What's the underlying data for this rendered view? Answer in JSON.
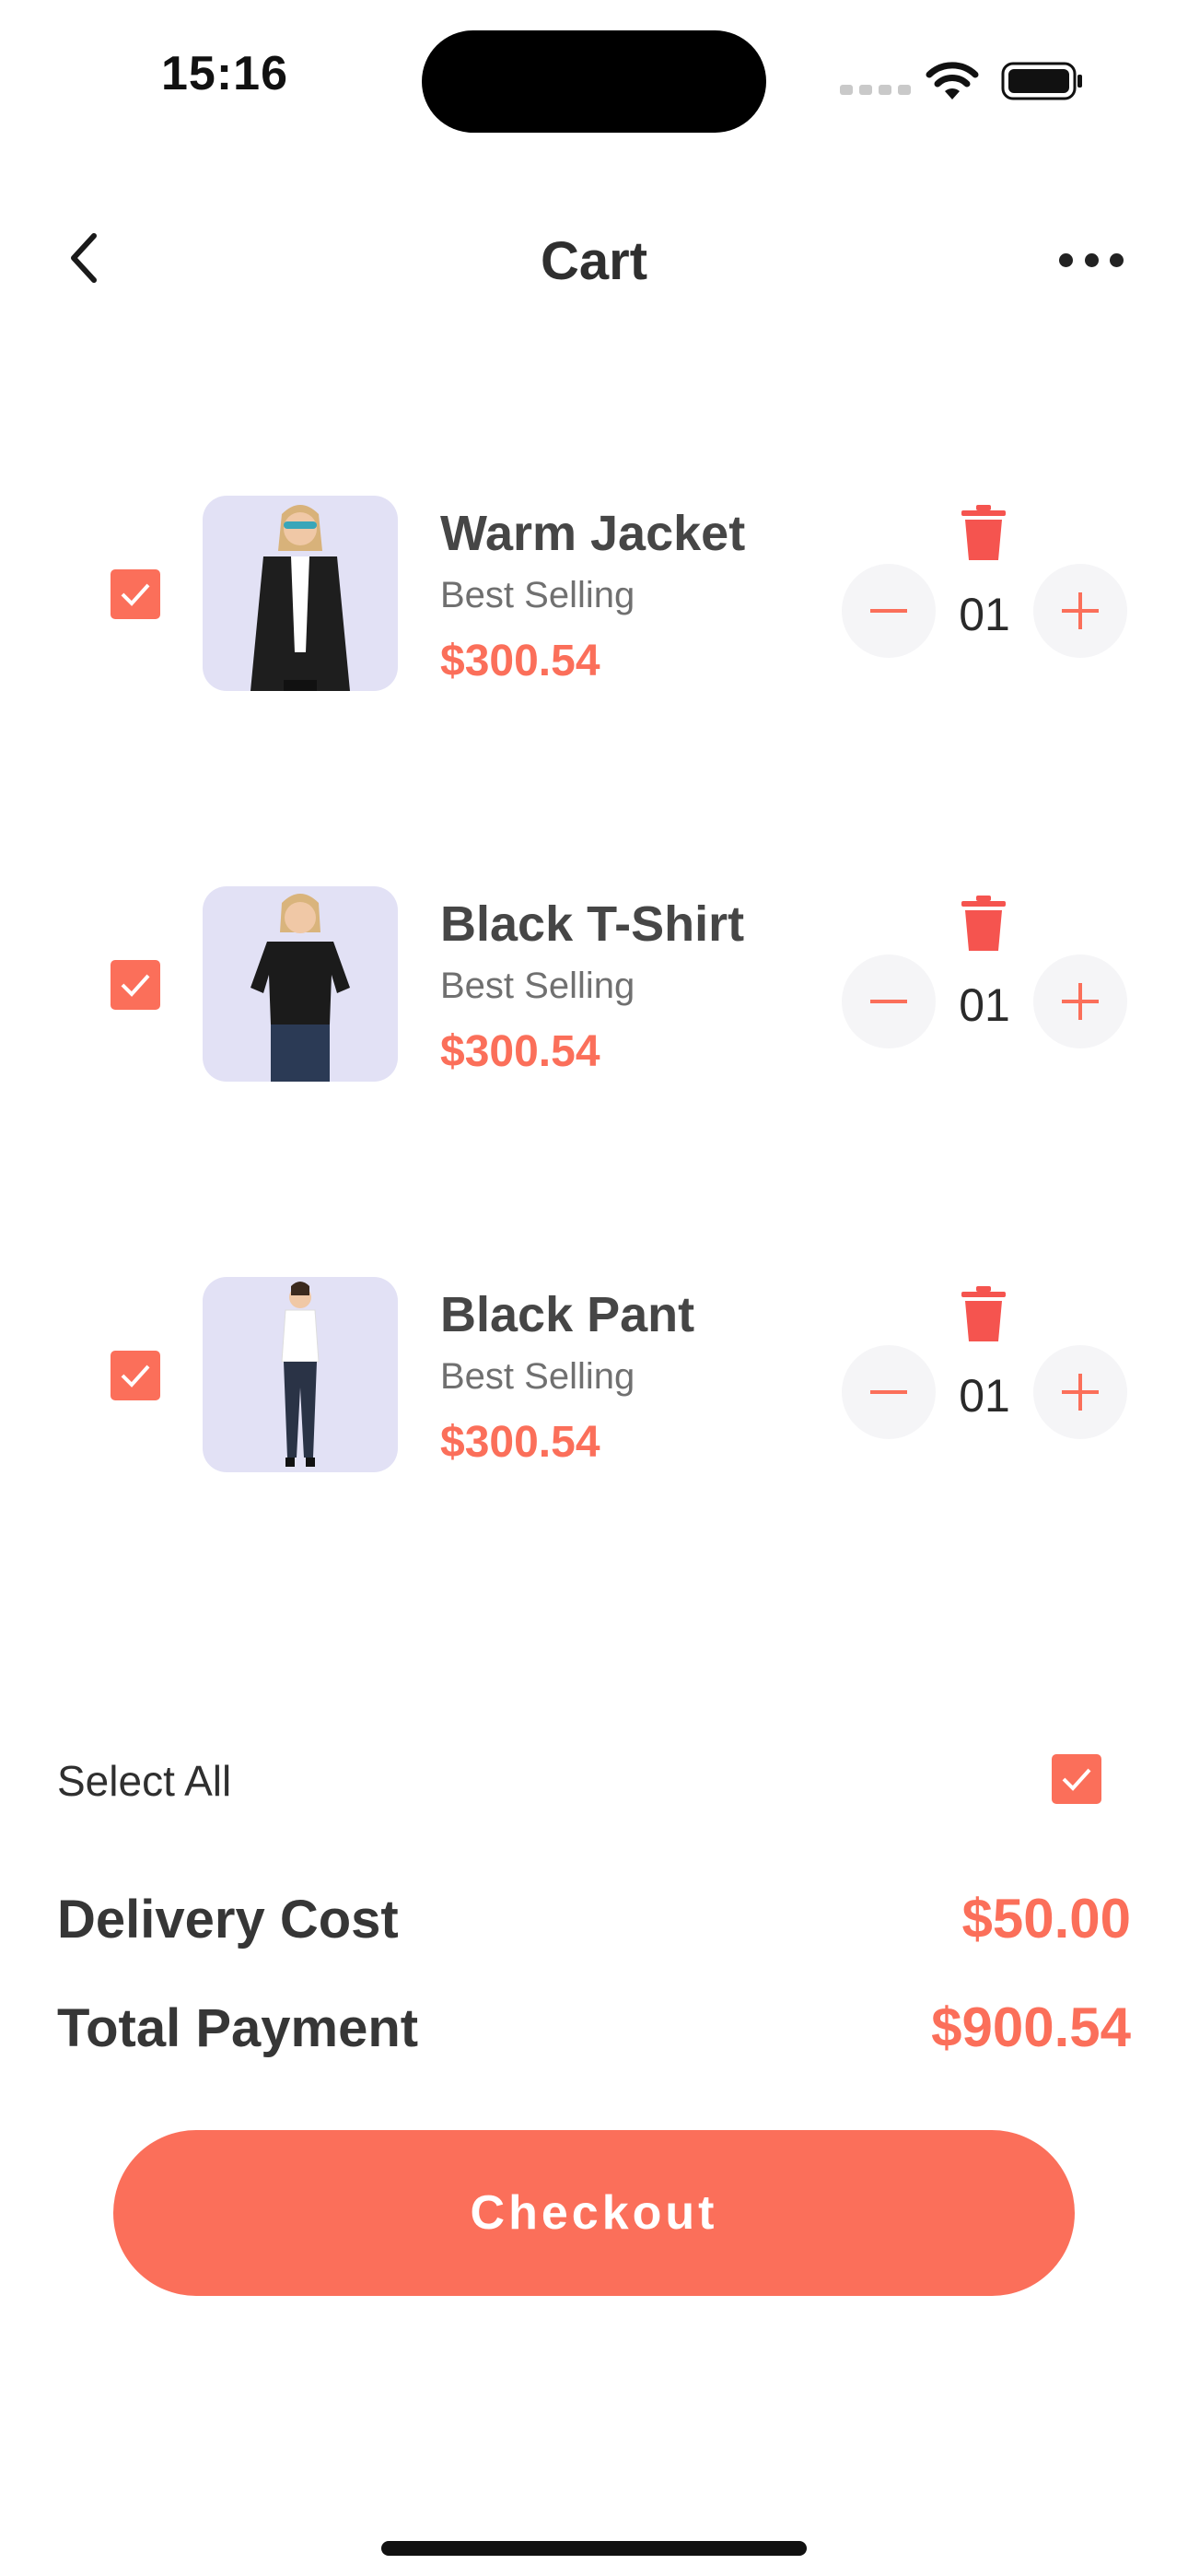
{
  "status_bar": {
    "time": "15:16"
  },
  "nav": {
    "title": "Cart",
    "back_icon": "chevron-left-icon",
    "more_icon": "more-horizontal-icon"
  },
  "items": [
    {
      "name": "Warm Jacket",
      "subtitle": "Best Selling",
      "price": "$300.54",
      "quantity": "01",
      "checked": true
    },
    {
      "name": "Black T-Shirt",
      "subtitle": "Best Selling",
      "price": "$300.54",
      "quantity": "01",
      "checked": true
    },
    {
      "name": "Black Pant",
      "subtitle": "Best Selling",
      "price": "$300.54",
      "quantity": "01",
      "checked": true
    }
  ],
  "summary": {
    "select_all_label": "Select All",
    "select_all_checked": true,
    "delivery_label": "Delivery Cost",
    "delivery_value": "$50.00",
    "total_label": "Total Payment",
    "total_value": "$900.54"
  },
  "checkout_label": "Checkout",
  "colors": {
    "accent": "#fb6f5a",
    "trash": "#f5544f",
    "thumb_bg": "#e2e1f5"
  }
}
